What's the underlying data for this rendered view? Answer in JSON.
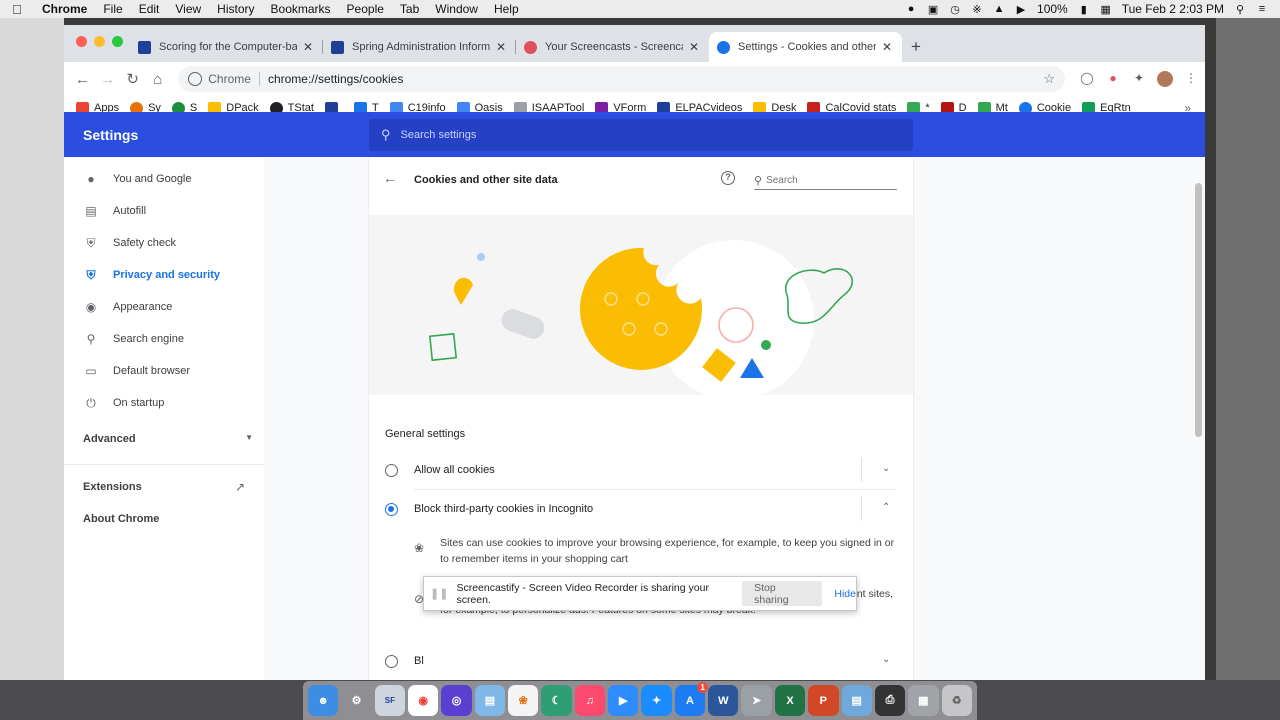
{
  "menubar": {
    "app": "Chrome",
    "items": [
      "File",
      "Edit",
      "View",
      "History",
      "Bookmarks",
      "People",
      "Tab",
      "Window",
      "Help"
    ],
    "battery": "100%",
    "datetime": "Tue Feb 2  2:03 PM"
  },
  "tabs": [
    {
      "title": "Scoring for the Computer-base",
      "color": "#1f3f99"
    },
    {
      "title": "Spring Administration Informat",
      "color": "#1f3f99"
    },
    {
      "title": "Your Screencasts - Screencast",
      "color": "#e0505a"
    },
    {
      "title": "Settings - Cookies and other s",
      "color": "#1a73e8"
    }
  ],
  "omnibox": {
    "chip": "Chrome",
    "url": "chrome://settings/cookies"
  },
  "bookmarks": [
    {
      "label": "Apps",
      "color": "#ea4335"
    },
    {
      "label": "Sy",
      "color": "#e8710a"
    },
    {
      "label": "S",
      "color": "#1e8e3e"
    },
    {
      "label": "DPack",
      "color": "#fbbc04"
    },
    {
      "label": "TStat",
      "color": "#202124"
    },
    {
      "label": "",
      "color": "#1f3f99"
    },
    {
      "label": "T",
      "color": "#1a73e8"
    },
    {
      "label": "C19info",
      "color": "#4285f4"
    },
    {
      "label": "Oasis",
      "color": "#4285f4"
    },
    {
      "label": "ISAAPTool",
      "color": "#5f6368"
    },
    {
      "label": "VForm",
      "color": "#7b1fa2"
    },
    {
      "label": "ELPACvideos",
      "color": "#1f3f99"
    },
    {
      "label": "Desk",
      "color": "#fbbc04"
    },
    {
      "label": "CalCovid stats",
      "color": "#c5221f"
    },
    {
      "label": "*",
      "color": "#34a853"
    },
    {
      "label": "D",
      "color": "#b31412"
    },
    {
      "label": "Mt",
      "color": "#34a853"
    },
    {
      "label": "Cookie",
      "color": "#1a73e8"
    },
    {
      "label": "EqRtn",
      "color": "#0f9d58"
    }
  ],
  "settings": {
    "header_title": "Settings",
    "search_placeholder": "Search settings",
    "nav": [
      {
        "label": "You and Google",
        "icon": "person-icon"
      },
      {
        "label": "Autofill",
        "icon": "clipboard-icon"
      },
      {
        "label": "Safety check",
        "icon": "shield-check-icon"
      },
      {
        "label": "Privacy and security",
        "icon": "shield-icon",
        "active": true
      },
      {
        "label": "Appearance",
        "icon": "palette-icon"
      },
      {
        "label": "Search engine",
        "icon": "search-icon"
      },
      {
        "label": "Default browser",
        "icon": "browser-icon"
      },
      {
        "label": "On startup",
        "icon": "power-icon"
      }
    ],
    "advanced": "Advanced",
    "extensions": "Extensions",
    "about": "About Chrome"
  },
  "card": {
    "title": "Cookies and other site data",
    "search_placeholder": "Search",
    "general_title": "General settings",
    "options": [
      {
        "label": "Allow all cookies",
        "selected": false,
        "expanded": false
      },
      {
        "label": "Block third-party cookies in Incognito",
        "selected": true,
        "expanded": true
      }
    ],
    "details": [
      "Sites can use cookies to improve your browsing experience, for example, to keep you signed in or to remember items in your shopping cart",
      "While in incognito, sites can't use your cookies to see your browsing activity across different sites, for example, to personalize ads. Features on some sites may break."
    ],
    "next_option_partial": "Bl"
  },
  "sharebar": {
    "message": "Screencastify - Screen Video Recorder is sharing your screen.",
    "stop": "Stop sharing",
    "hide": "Hide"
  },
  "dock": {
    "badge": "1"
  }
}
